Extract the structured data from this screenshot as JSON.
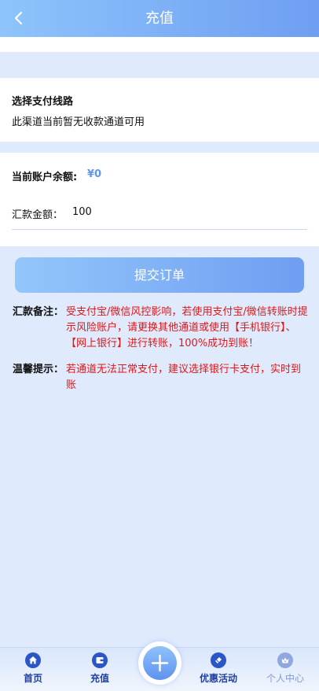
{
  "header": {
    "title": "充值",
    "back_icon": "chevron-left-icon"
  },
  "route": {
    "title": "选择支付线路",
    "message": "此渠道当前暂无收款通道可用"
  },
  "form": {
    "balance_label": "当前账户余额:",
    "balance_value": "¥0",
    "amount_label": "汇款金额：",
    "amount_value": "100"
  },
  "submit": {
    "label": "提交订单"
  },
  "notes": {
    "remark_label": "汇款备注：",
    "remark_text": "受支付宝/微信风控影响，若使用支付宝/微信转账时提示风险账户，请更换其他通道或使用【手机银行】、【网上银行】进行转账，100%成功到账！",
    "tip_label": "温馨提示：",
    "tip_text": "若通道无法正常支付，建议选择银行卡支付，实时到账"
  },
  "nav": {
    "items": [
      {
        "label": "首页",
        "icon": "home-icon"
      },
      {
        "label": "充值",
        "icon": "wallet-icon"
      },
      {
        "label": "优惠活动",
        "icon": "gift-icon"
      },
      {
        "label": "个人中心",
        "icon": "user-crown-icon"
      }
    ],
    "center_icon": "plus-icon"
  },
  "colors": {
    "header_gradient": [
      "#8ec4fb",
      "#6f9ef2"
    ],
    "accent_blue": "#5f97ee",
    "warning_red": "#e01717",
    "nav_blue": "#1e3f9e"
  }
}
